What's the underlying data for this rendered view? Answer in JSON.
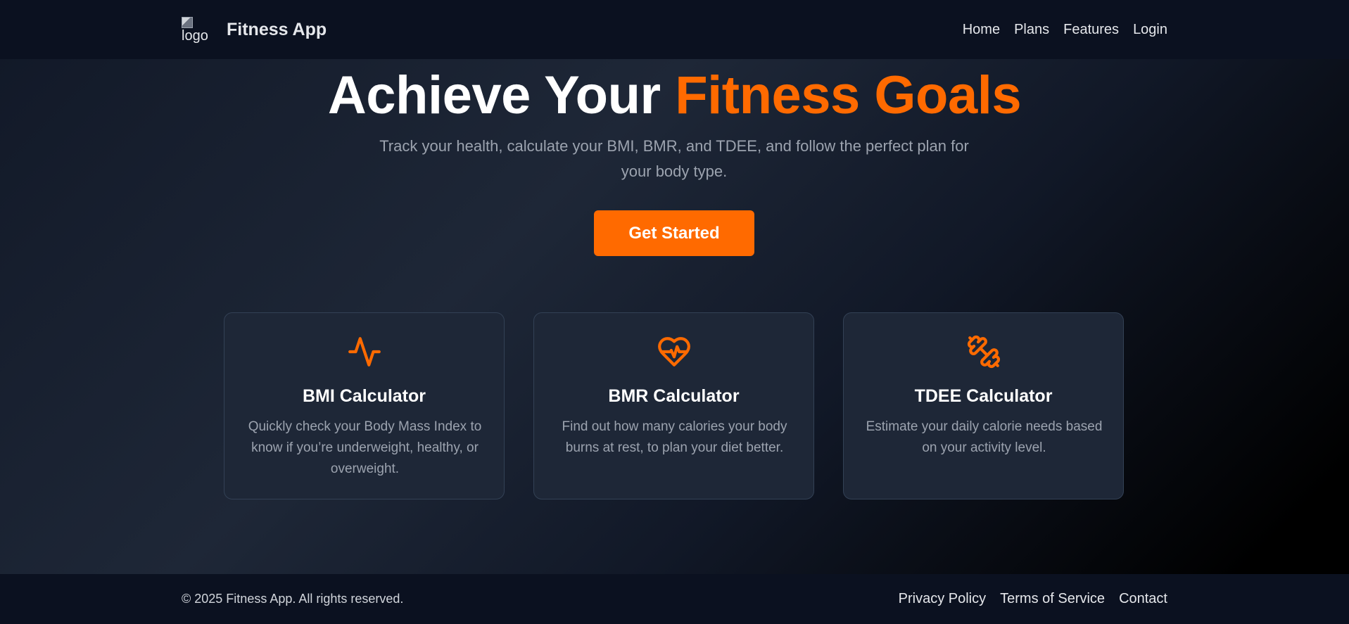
{
  "colors": {
    "accent": "#ff6a00",
    "background": "#111827",
    "header_bg": "#0b1120",
    "card_bg": "#1e2737",
    "muted_text": "#9ca3af"
  },
  "header": {
    "logo_alt": "logo",
    "brand": "Fitness App",
    "nav": [
      "Home",
      "Plans",
      "Features",
      "Login"
    ]
  },
  "hero": {
    "title_main": "Achieve Your ",
    "title_accent": "Fitness Goals",
    "subtitle": "Track your health, calculate your BMI, BMR, and TDEE, and follow the perfect plan for your body type.",
    "cta": "Get Started"
  },
  "cards": [
    {
      "icon": "activity-icon",
      "title": "BMI Calculator",
      "description": "Quickly check your Body Mass Index to know if you’re underweight, healthy, or overweight."
    },
    {
      "icon": "heart-pulse-icon",
      "title": "BMR Calculator",
      "description": "Find out how many calories your body burns at rest, to plan your diet better."
    },
    {
      "icon": "dumbbell-icon",
      "title": "TDEE Calculator",
      "description": "Estimate your daily calorie needs based on your activity level."
    }
  ],
  "footer": {
    "copyright": "© 2025 Fitness App. All rights reserved.",
    "links": [
      "Privacy Policy",
      "Terms of Service",
      "Contact"
    ]
  }
}
